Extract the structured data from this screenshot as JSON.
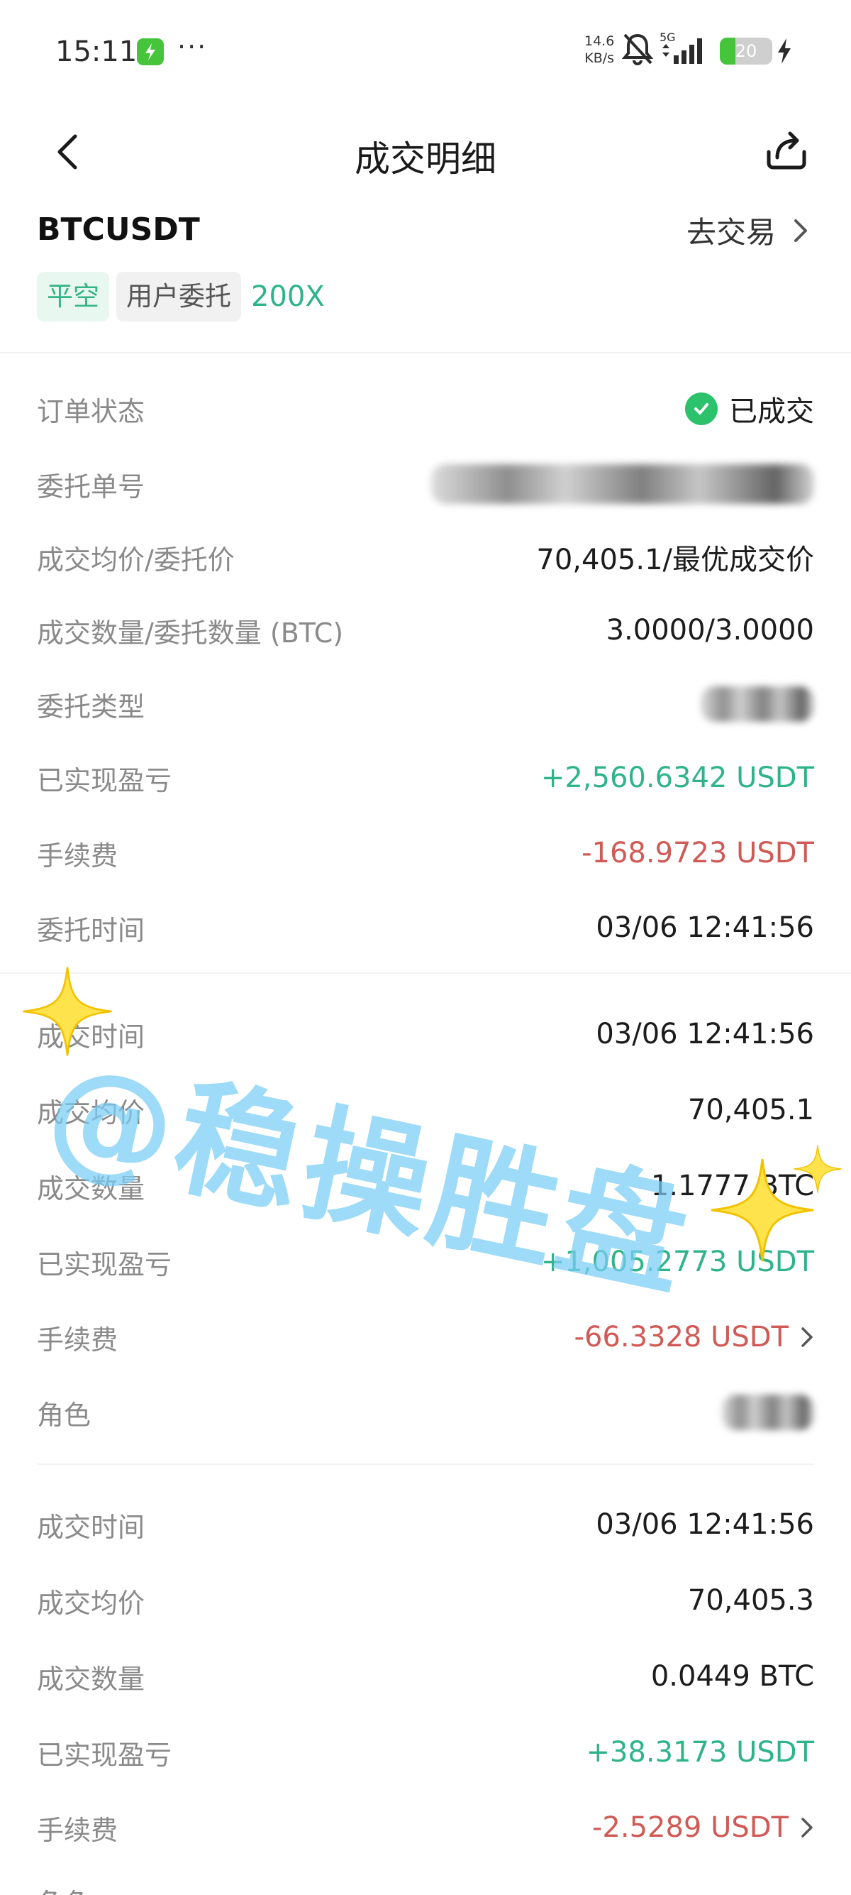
{
  "status_bar": {
    "time": "15:11",
    "dots": "···",
    "net_speed_value": "14.6",
    "net_speed_unit": "KB/s",
    "network": "5G",
    "battery": "20"
  },
  "nav": {
    "title": "成交明细"
  },
  "header": {
    "symbol": "BTCUSDT",
    "go_trade": "去交易",
    "tags": {
      "side": "平空",
      "type": "用户委托",
      "leverage": "200X"
    }
  },
  "order": {
    "status": {
      "label": "订单状态",
      "value": "已成交"
    },
    "order_id": {
      "label": "委托单号"
    },
    "price": {
      "label": "成交均价/委托价",
      "value": "70,405.1/最优成交价"
    },
    "qty": {
      "label": "成交数量/委托数量 (BTC)",
      "value": "3.0000/3.0000"
    },
    "order_type": {
      "label": "委托类型"
    },
    "pnl": {
      "label": "已实现盈亏",
      "value": "+2,560.6342 USDT"
    },
    "fee": {
      "label": "手续费",
      "value": "-168.9723 USDT"
    },
    "time": {
      "label": "委托时间",
      "value": "03/06 12:41:56"
    }
  },
  "fills": [
    {
      "time": {
        "label": "成交时间",
        "value": "03/06 12:41:56"
      },
      "avg_price": {
        "label": "成交均价",
        "value": "70,405.1"
      },
      "qty": {
        "label": "成交数量",
        "value": "1.1777 BTC"
      },
      "pnl": {
        "label": "已实现盈亏",
        "value": "+1,005.2773 USDT"
      },
      "fee": {
        "label": "手续费",
        "value": "-66.3328 USDT"
      },
      "role": {
        "label": "角色"
      }
    },
    {
      "time": {
        "label": "成交时间",
        "value": "03/06 12:41:56"
      },
      "avg_price": {
        "label": "成交均价",
        "value": "70,405.3"
      },
      "qty": {
        "label": "成交数量",
        "value": "0.0449 BTC"
      },
      "pnl": {
        "label": "已实现盈亏",
        "value": "+38.3173 USDT"
      },
      "fee": {
        "label": "手续费",
        "value": "-2.5289 USDT"
      },
      "role": {
        "label": "角色"
      }
    }
  ],
  "watermark": "@稳操胜盘",
  "colors": {
    "green": "#2eb38a",
    "red": "#d05a55",
    "check": "#2cc26c"
  }
}
